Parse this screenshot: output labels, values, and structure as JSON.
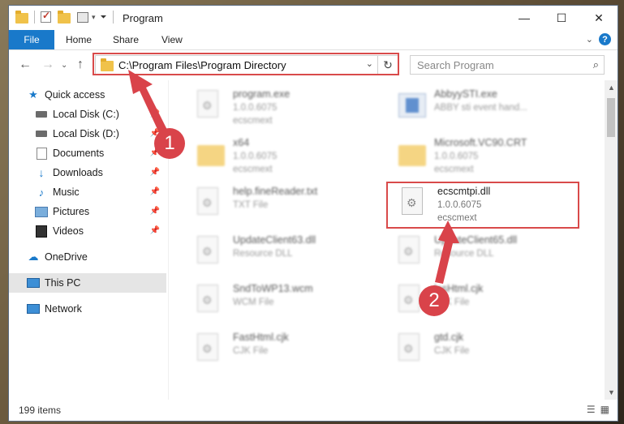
{
  "window": {
    "title": "Program",
    "controls": {
      "minimize": "—",
      "maximize": "☐",
      "close": "✕"
    }
  },
  "ribbon": {
    "tabs": [
      "File",
      "Home",
      "Share",
      "View"
    ],
    "help": "?"
  },
  "navigation": {
    "address_path": "C:\\Program Files\\Program Directory",
    "search_placeholder": "Search Program"
  },
  "sidebar": {
    "items": [
      {
        "label": "Quick access",
        "icon": "star-icon"
      },
      {
        "label": "Local Disk (C:)",
        "icon": "drive-icon"
      },
      {
        "label": "Local Disk (D:)",
        "icon": "drive-icon"
      },
      {
        "label": "Documents",
        "icon": "documents-icon"
      },
      {
        "label": "Downloads",
        "icon": "download-icon"
      },
      {
        "label": "Music",
        "icon": "music-icon"
      },
      {
        "label": "Pictures",
        "icon": "pictures-icon"
      },
      {
        "label": "Videos",
        "icon": "videos-icon"
      },
      {
        "label": "OneDrive",
        "icon": "cloud-icon"
      },
      {
        "label": "This PC",
        "icon": "computer-icon",
        "selected": true
      },
      {
        "label": "Network",
        "icon": "network-icon"
      }
    ]
  },
  "files": [
    {
      "name": "program.exe",
      "line1": "1.0.0.6075",
      "line2": "ecscmext"
    },
    {
      "name": "AbbyySTI.exe",
      "line1": "ABBY sti event hand...",
      "line2": ""
    },
    {
      "name": "x64",
      "line1": "1.0.0.6075",
      "line2": "ecscmext"
    },
    {
      "name": "Microsoft.VC90.CRT",
      "line1": "1.0.0.6075",
      "line2": "ecscmext"
    },
    {
      "name": "help.fineReader.txt",
      "line1": "TXT File",
      "line2": ""
    },
    {
      "name": "ecscmtpi.dll",
      "line1": "1.0.0.6075",
      "line2": "ecscmext"
    },
    {
      "name": "UpdateClient63.dll",
      "line1": "Resource DLL",
      "line2": ""
    },
    {
      "name": "UpdateClient65.dll",
      "line1": "Resource DLL",
      "line2": ""
    },
    {
      "name": "SndToWP13.wcm",
      "line1": "WCM File",
      "line2": ""
    },
    {
      "name": "lesHtml.cjk",
      "line1": "CJK File",
      "line2": ""
    },
    {
      "name": "FastHtml.cjk",
      "line1": "CJK File",
      "line2": ""
    },
    {
      "name": "gtd.cjk",
      "line1": "CJK File",
      "line2": ""
    }
  ],
  "status": {
    "item_count": "199 items"
  },
  "annotations": {
    "badge1": "1",
    "badge2": "2"
  },
  "colors": {
    "accent": "#1979ca",
    "annotation_red": "#d94a4a"
  }
}
